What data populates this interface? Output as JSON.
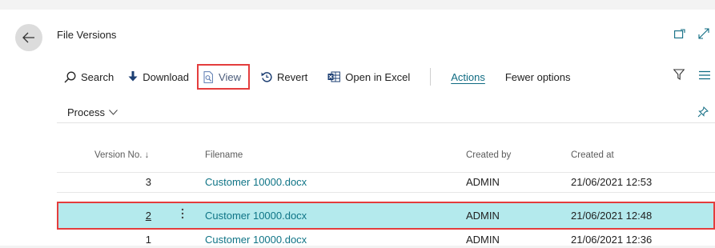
{
  "header": {
    "title": "File Versions"
  },
  "toolbar": {
    "search": "Search",
    "download": "Download",
    "view": "View",
    "revert": "Revert",
    "open_in_excel": "Open in Excel",
    "actions": "Actions",
    "fewer_options": "Fewer options"
  },
  "process_menu": {
    "label": "Process"
  },
  "table": {
    "columns": [
      "Version No.",
      "Filename",
      "Created by",
      "Created at"
    ],
    "sort_indicator": "↓",
    "rows": [
      {
        "version": "3",
        "filename": "Customer 10000.docx",
        "created_by": "ADMIN",
        "created_at": "21/06/2021 12:53"
      },
      {
        "version": "2",
        "filename": "Customer 10000.docx",
        "created_by": "ADMIN",
        "created_at": "21/06/2021 12:48"
      },
      {
        "version": "1",
        "filename": "Customer 10000.docx",
        "created_by": "ADMIN",
        "created_at": "21/06/2021 12:36"
      }
    ]
  },
  "icons": {
    "back": "back-arrow-icon",
    "open_new_window": "open-new-window-icon",
    "expand": "expand-icon",
    "search": "search-icon",
    "download": "download-icon",
    "view": "view-document-icon",
    "revert": "revert-icon",
    "excel": "excel-icon",
    "filter": "filter-icon",
    "list": "list-icon",
    "pin": "pin-icon",
    "chevron": "chevron-down-icon",
    "more": "more-options-icon"
  },
  "colors": {
    "accent": "#0f6b82",
    "link": "#0f7486",
    "selected_row": "#b4eaed",
    "highlight_box": "#e43d3d"
  }
}
